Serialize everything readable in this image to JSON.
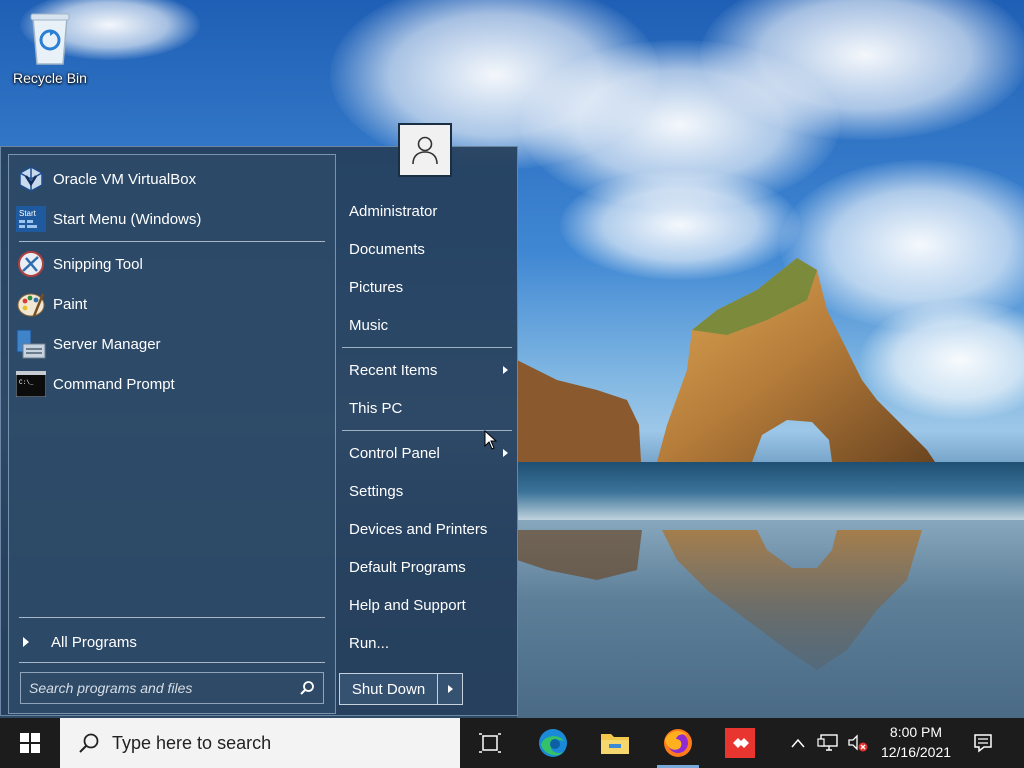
{
  "desktop": {
    "icons": [
      {
        "label": "Recycle Bin",
        "icon": "recycle-bin-icon"
      }
    ]
  },
  "start_menu": {
    "programs_pinned": [
      {
        "label": "Oracle VM VirtualBox",
        "icon": "virtualbox-icon"
      },
      {
        "label": "Start Menu (Windows)",
        "icon": "start-menu-icon"
      }
    ],
    "programs_recent": [
      {
        "label": "Snipping Tool",
        "icon": "snipping-tool-icon"
      },
      {
        "label": "Paint",
        "icon": "paint-icon"
      },
      {
        "label": "Server Manager",
        "icon": "server-manager-icon"
      },
      {
        "label": "Command Prompt",
        "icon": "command-prompt-icon"
      }
    ],
    "start_icon_text": "Start",
    "cmd_icon_text": "C:\\_",
    "all_programs_label": "All Programs",
    "search_placeholder": "Search programs and files",
    "user_icon": "user-icon",
    "places": [
      {
        "label": "Administrator",
        "has_submenu": false
      },
      {
        "label": "Documents",
        "has_submenu": false
      },
      {
        "label": "Pictures",
        "has_submenu": false
      },
      {
        "label": "Music",
        "has_submenu": false
      },
      {
        "label": "Recent Items",
        "has_submenu": true
      },
      {
        "label": "This PC",
        "has_submenu": false
      },
      {
        "label": "Control Panel",
        "has_submenu": true
      },
      {
        "label": "Settings",
        "has_submenu": false
      },
      {
        "label": "Devices and Printers",
        "has_submenu": false
      },
      {
        "label": "Default Programs",
        "has_submenu": false
      },
      {
        "label": "Help and Support",
        "has_submenu": false
      },
      {
        "label": "Run...",
        "has_submenu": false
      }
    ],
    "shutdown_label": "Shut Down"
  },
  "taskbar": {
    "search_placeholder": "Type here to search",
    "apps": [
      {
        "name": "Task View",
        "icon": "task-view-icon",
        "active": false
      },
      {
        "name": "Microsoft Edge",
        "icon": "edge-icon",
        "active": false
      },
      {
        "name": "File Explorer",
        "icon": "file-explorer-icon",
        "active": false
      },
      {
        "name": "Firefox",
        "icon": "firefox-icon",
        "active": true
      },
      {
        "name": "AnyDesk",
        "icon": "anydesk-icon",
        "active": false
      }
    ],
    "clock": {
      "time": "8:00 PM",
      "date": "12/16/2021"
    }
  },
  "colors": {
    "start_menu_bg": "#26405c",
    "taskbar_bg": "#1c1c1c",
    "accent": "#79a8db"
  }
}
